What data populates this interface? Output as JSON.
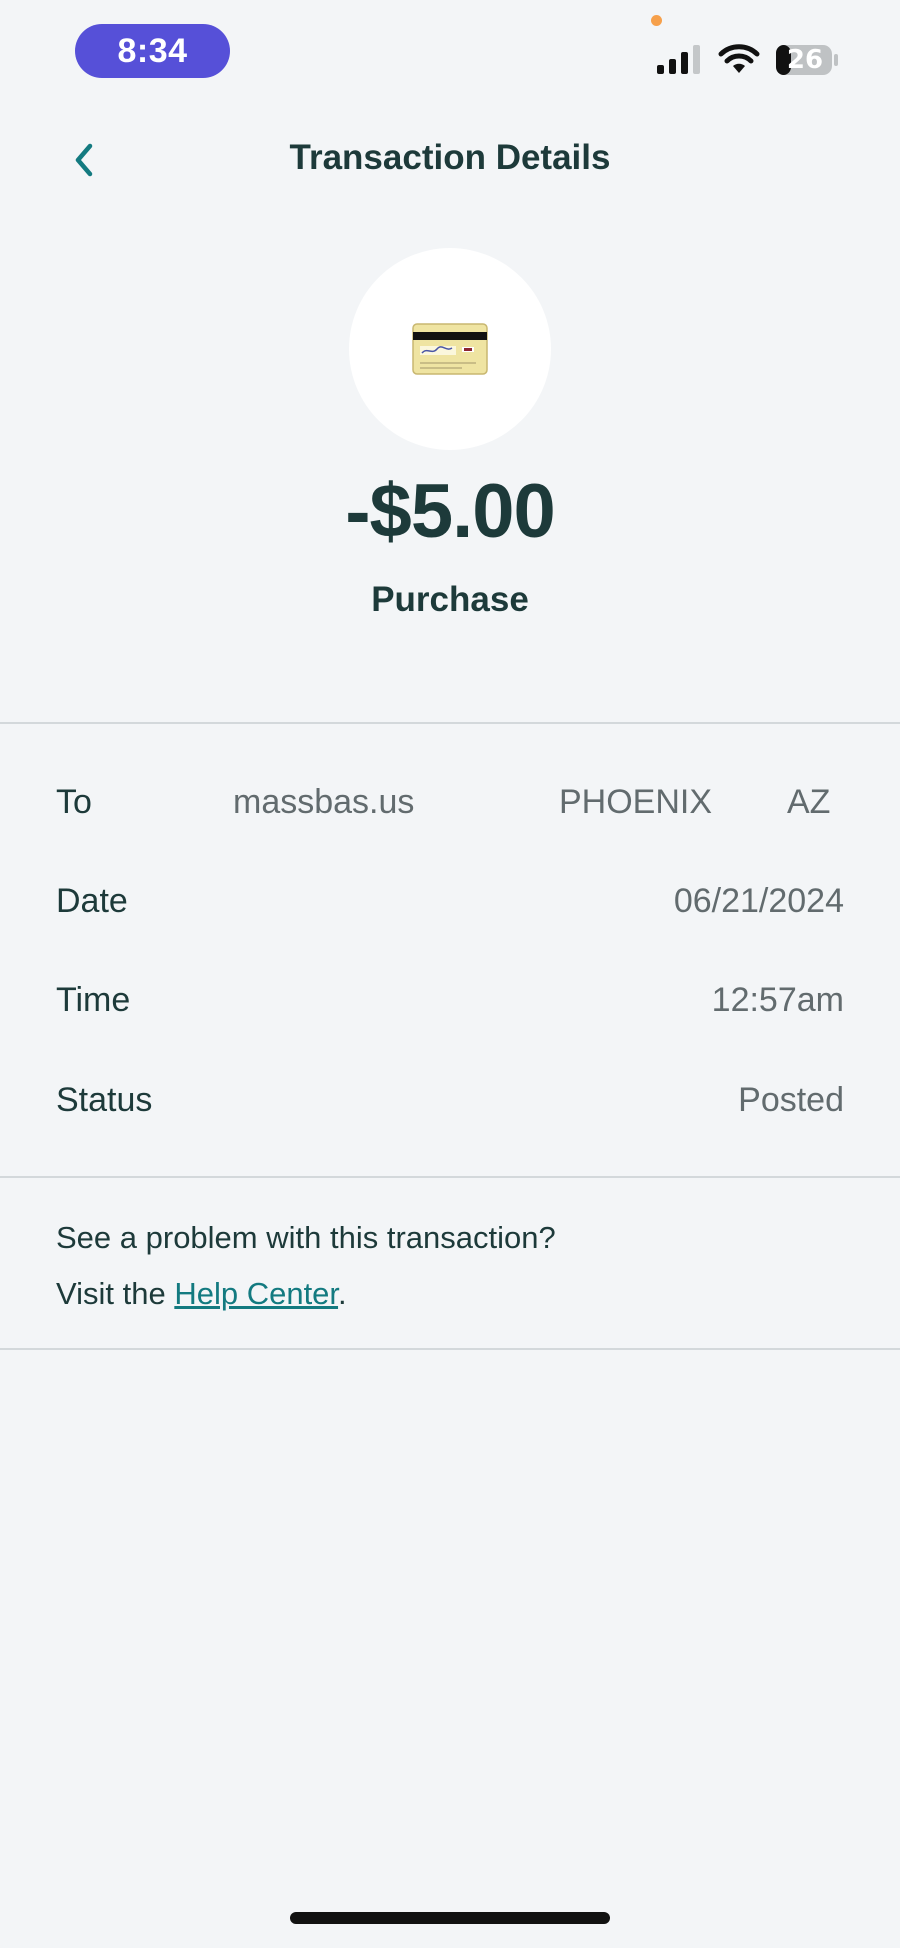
{
  "status_bar": {
    "time": "8:34",
    "battery_level": "26",
    "icons": [
      "microphone-indicator-dot",
      "cellular-signal-icon",
      "wifi-icon",
      "battery-icon"
    ]
  },
  "header": {
    "title": "Transaction Details",
    "back_icon": "chevron-left-icon"
  },
  "transaction": {
    "icon": "credit-card-icon",
    "amount": "-$5.00",
    "type": "Purchase"
  },
  "details": {
    "to": {
      "label": "To",
      "merchant": "massbas.us",
      "city": "PHOENIX",
      "state": "AZ"
    },
    "date": {
      "label": "Date",
      "value": "06/21/2024"
    },
    "time": {
      "label": "Time",
      "value": "12:57am"
    },
    "status": {
      "label": "Status",
      "value": "Posted"
    }
  },
  "help": {
    "line1": "See a problem with this transaction?",
    "line2_prefix": "Visit the ",
    "link_label": "Help Center",
    "line2_suffix": "."
  },
  "colors": {
    "background": "#f3f5f7",
    "text_primary": "#1d3a3a",
    "text_secondary": "#626b6e",
    "accent": "#137a80",
    "time_pill": "#5650d8",
    "divider": "#d3d8db"
  }
}
